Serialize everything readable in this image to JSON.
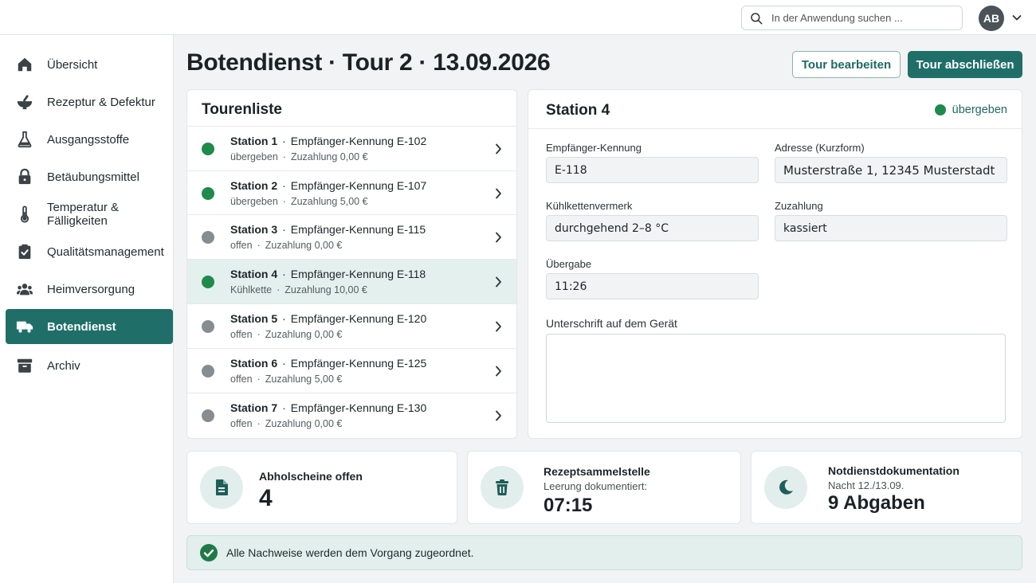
{
  "search": {
    "placeholder": "In der Anwendung suchen ..."
  },
  "user": {
    "initials": "AB"
  },
  "sidebar": {
    "items": [
      {
        "label": "Übersicht",
        "icon": "home-icon",
        "active": false
      },
      {
        "label": "Rezeptur & Defektur",
        "icon": "mortar-pestle-icon",
        "active": false
      },
      {
        "label": "Ausgangsstoffe",
        "icon": "flask-icon",
        "active": false
      },
      {
        "label": "Betäubungsmittel",
        "icon": "lock-icon",
        "active": false
      },
      {
        "label": "Temperatur & Fälligkeiten",
        "icon": "thermometer-icon",
        "active": false
      },
      {
        "label": "Qualitätsmanagement",
        "icon": "clipboard-check-icon",
        "active": false
      },
      {
        "label": "Heimversorgung",
        "icon": "people-icon",
        "active": false
      },
      {
        "label": "Botendienst",
        "icon": "truck-icon",
        "active": true
      },
      {
        "label": "Archiv",
        "icon": "archive-icon",
        "active": false
      }
    ]
  },
  "header": {
    "title": "Botendienst · Tour 2 · 13.09.2026",
    "edit_label": "Tour bearbeiten",
    "finish_label": "Tour abschließen"
  },
  "tour": {
    "title": "Tourenliste",
    "rows": [
      {
        "station": "Station 1",
        "recipient": "Empfänger-Kennung E-102",
        "status": "übergeben",
        "payment": "Zuzahlung 0,00 €",
        "dot": "green",
        "selected": false
      },
      {
        "station": "Station 2",
        "recipient": "Empfänger-Kennung E-107",
        "status": "übergeben",
        "payment": "Zuzahlung 5,00 €",
        "dot": "green",
        "selected": false
      },
      {
        "station": "Station 3",
        "recipient": "Empfänger-Kennung E-115",
        "status": "offen",
        "payment": "Zuzahlung 0,00 €",
        "dot": "grey",
        "selected": false
      },
      {
        "station": "Station 4",
        "recipient": "Empfänger-Kennung E-118",
        "status": "Kühlkette",
        "payment": "Zuzahlung 10,00 €",
        "dot": "green",
        "selected": true
      },
      {
        "station": "Station 5",
        "recipient": "Empfänger-Kennung E-120",
        "status": "offen",
        "payment": "Zuzahlung 0,00 €",
        "dot": "grey",
        "selected": false
      },
      {
        "station": "Station 6",
        "recipient": "Empfänger-Kennung E-125",
        "status": "offen",
        "payment": "Zuzahlung 5,00 €",
        "dot": "grey",
        "selected": false
      },
      {
        "station": "Station 7",
        "recipient": "Empfänger-Kennung E-130",
        "status": "offen",
        "payment": "Zuzahlung 0,00 €",
        "dot": "grey",
        "selected": false
      }
    ]
  },
  "detail": {
    "title": "Station 4",
    "status": "übergeben",
    "fields": {
      "recipient_label": "Empfänger-Kennung",
      "recipient_value": "E-118",
      "address_label": "Adresse (Kurzform)",
      "address_value": "Musterstraße 1, 12345 Musterstadt",
      "cold_label": "Kühlkettenvermerk",
      "cold_value": "durchgehend 2–8 °C",
      "payment_label": "Zuzahlung",
      "payment_value": "kassiert",
      "handover_label": "Übergabe",
      "handover_value": "11:26",
      "signature_label": "Unterschrift auf dem Gerät"
    }
  },
  "stats": {
    "pickup": {
      "title": "Abholscheine offen",
      "value": "4"
    },
    "collection": {
      "title": "Rezeptsammelstelle",
      "sub": "Leerung dokumentiert:",
      "value": "07:15"
    },
    "emergency": {
      "title": "Notdienstdokumentation",
      "sub": "Nacht 12./13.09.",
      "value": "9 Abgaben"
    }
  },
  "notice": {
    "text": "Alle Nachweise werden dem Vorgang zugeordnet."
  },
  "colors": {
    "accent": "#1f6f68",
    "success": "#1f8a4c",
    "muted": "#868d91"
  }
}
